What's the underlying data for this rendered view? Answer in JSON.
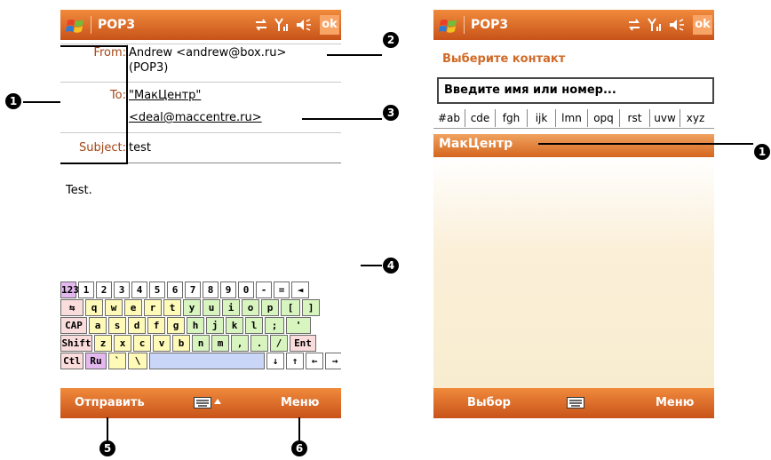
{
  "left_screen": {
    "title": "POP3",
    "ok_label": "ok",
    "from_label": "From:",
    "from_value_line1": "Andrew <andrew@box.ru>",
    "from_value_line2": "(POP3)",
    "to_label": "To:",
    "to_value_line1": "\"МакЦентр\"",
    "to_value_line2": "<deal@maccentre.ru>",
    "subject_label": "Subject:",
    "subject_value": "test",
    "body_text": "Test.",
    "softkey_left": "Отправить",
    "softkey_right": "Меню",
    "keyboard": {
      "row1": [
        "123",
        "1",
        "2",
        "3",
        "4",
        "5",
        "6",
        "7",
        "8",
        "9",
        "0",
        "-",
        "=",
        "◄"
      ],
      "row2": [
        "⇆",
        "q",
        "w",
        "e",
        "r",
        "t",
        "y",
        "u",
        "i",
        "o",
        "p",
        "[",
        "]"
      ],
      "row3": [
        "CAP",
        "a",
        "s",
        "d",
        "f",
        "g",
        "h",
        "j",
        "k",
        "l",
        ";",
        "'"
      ],
      "row4": [
        "Shift",
        "z",
        "x",
        "c",
        "v",
        "b",
        "n",
        "m",
        ",",
        ".",
        "/",
        "Ent"
      ],
      "row5": [
        "Ctl",
        "Ru",
        "`",
        "\\",
        "",
        "↓",
        "↑",
        "←",
        "→"
      ]
    }
  },
  "right_screen": {
    "title": "POP3",
    "ok_label": "ok",
    "subtitle": "Выберите контакт",
    "search_placeholder": "Введите имя или номер...",
    "tabs": [
      "#ab",
      "cde",
      "fgh",
      "ijk",
      "lmn",
      "opq",
      "rst",
      "uvw",
      "xyz"
    ],
    "contact": "МакЦентр",
    "softkey_left": "Выбор",
    "softkey_right": "Меню"
  },
  "callouts": {
    "c1_left": "1",
    "c2": "2",
    "c3": "3",
    "c4": "4",
    "c5": "5",
    "c6": "6",
    "c1_right": "1"
  },
  "colors": {
    "bar_top": "#f08a3c",
    "bar_bottom": "#c8531a",
    "label_brown": "#a44515",
    "subtitle_orange": "#d06a28"
  }
}
